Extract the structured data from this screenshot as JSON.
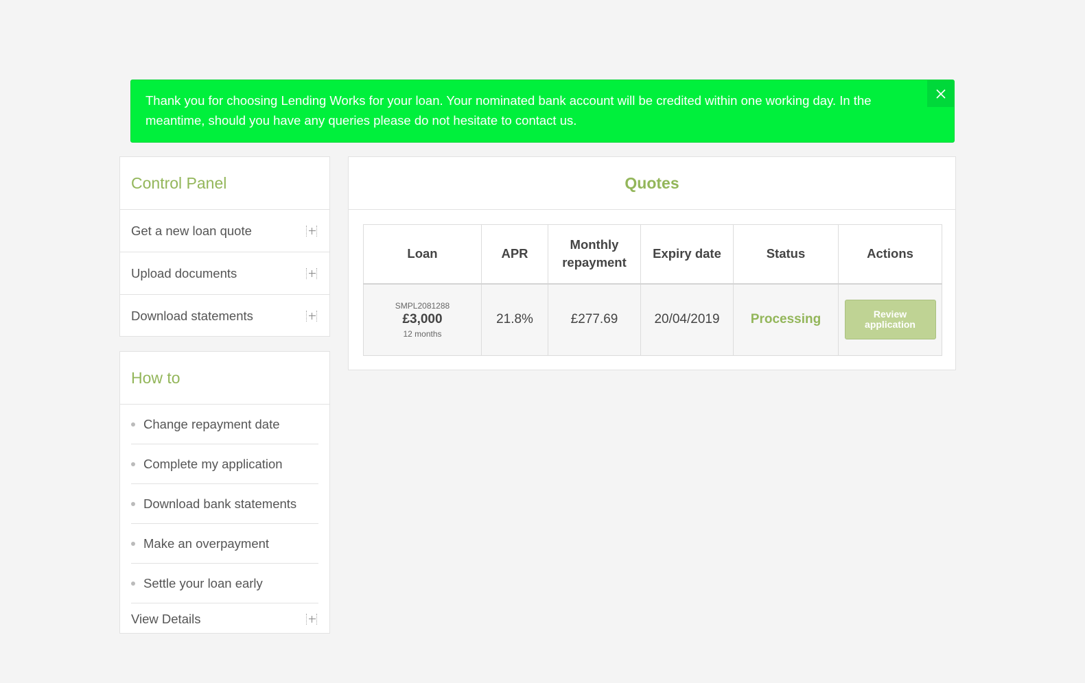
{
  "alert": {
    "message": "Thank you for choosing Lending Works for your loan. Your nominated bank account will be credited within one working day. In the meantime, should you have any queries please do not hesitate to contact us.",
    "close_icon": "close-icon",
    "background": "#00f03c"
  },
  "control_panel": {
    "title": "Control Panel",
    "items": [
      {
        "label": "Get a new loan quote",
        "icon": "expand-plus-icon"
      },
      {
        "label": "Upload documents",
        "icon": "expand-plus-icon"
      },
      {
        "label": "Download statements",
        "icon": "expand-plus-icon"
      }
    ]
  },
  "how_to": {
    "title": "How to",
    "items": [
      {
        "label": "Change repayment date"
      },
      {
        "label": "Complete my application"
      },
      {
        "label": "Download bank statements"
      },
      {
        "label": "Make an overpayment"
      },
      {
        "label": "Settle your loan early"
      }
    ],
    "view_details": "View Details"
  },
  "quotes": {
    "title": "Quotes",
    "columns": [
      "Loan",
      "APR",
      "Monthly repayment",
      "Expiry date",
      "Status",
      "Actions"
    ],
    "rows": [
      {
        "reference": "SMPL2081288",
        "amount": "£3,000",
        "term": "12 months",
        "apr": "21.8%",
        "monthly_repayment": "£277.69",
        "expiry_date": "20/04/2019",
        "status": "Processing",
        "action_line1": "Review",
        "action_line2": "application"
      }
    ]
  },
  "colors": {
    "accent": "#93b65a",
    "alert_green": "#00f03c",
    "button": "#bfd394",
    "background": "#f4f4f4"
  }
}
